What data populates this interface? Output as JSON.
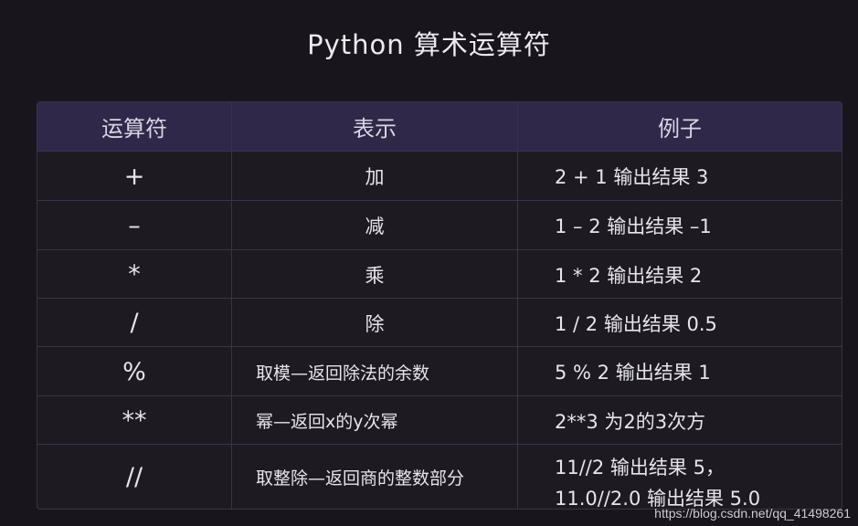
{
  "title": "Python 算术运算符",
  "table": {
    "headers": [
      "运算符",
      "表示",
      "例子"
    ],
    "rows": [
      {
        "operator": "+",
        "meaning": "加",
        "example": "2 + 1 输出结果 3"
      },
      {
        "operator": "–",
        "meaning": "减",
        "example": "1 – 2 输出结果 –1"
      },
      {
        "operator": "*",
        "meaning": "乘",
        "example": "1 * 2 输出结果 2"
      },
      {
        "operator": "/",
        "meaning": "除",
        "example": "1 / 2 输出结果 0.5"
      },
      {
        "operator": "%",
        "meaning": "取模—返回除法的余数",
        "example": "5 % 2 输出结果 1"
      },
      {
        "operator": "**",
        "meaning": "幂—返回x的y次幂",
        "example": "2**3 为2的3次方"
      },
      {
        "operator": "//",
        "meaning": "取整除—返回商的整数部分",
        "example": "11//2 输出结果 5，",
        "example2": "11.0//2.0 输出结果 5.0"
      }
    ]
  },
  "watermark": "https://blog.csdn.net/qq_41498261"
}
